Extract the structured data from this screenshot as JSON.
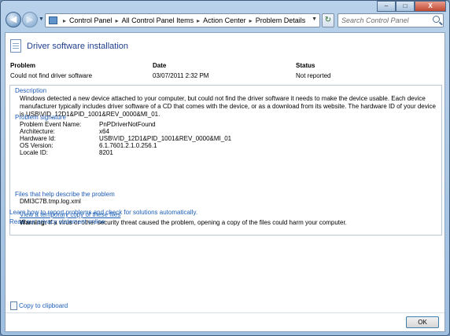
{
  "window": {
    "breadcrumbs": [
      "Control Panel",
      "All Control Panel Items",
      "Action Center",
      "Problem Details"
    ],
    "search_placeholder": "Search Control Panel",
    "buttons": {
      "minimize": "–",
      "maximize": "□",
      "close": "X"
    }
  },
  "page": {
    "title": "Driver software installation",
    "columns": {
      "problem_header": "Problem",
      "problem_value": "Could not find driver software",
      "date_header": "Date",
      "date_value": "03/07/2011 2:32 PM",
      "status_header": "Status",
      "status_value": "Not reported"
    },
    "description": {
      "title": "Description",
      "text": "Windows detected a new device attached to your computer, but could not find the driver software it needs to make the device usable. Each device manufacturer typically includes driver software of a CD that comes with the device, or as a download from its website. The hardware ID of your device is USB\\VID_12D1&PID_1001&REV_0000&MI_01."
    },
    "signature": {
      "title": "Problem signature",
      "rows": [
        {
          "label": "Problem Event Name:",
          "value": "PnPDriverNotFound"
        },
        {
          "label": "Architecture:",
          "value": "x64"
        },
        {
          "label": "Hardware Id:",
          "value": "USB\\VID_12D1&PID_1001&REV_0000&MI_01"
        },
        {
          "label": "OS Version:",
          "value": "6.1.7601.2.1.0.256.1"
        },
        {
          "label": "Locale ID:",
          "value": "8201"
        }
      ]
    },
    "files": {
      "title": "Files that help describe the problem",
      "file": "DMI3C7B.tmp.log.xml",
      "view_link": "View a temporary copy of these files",
      "warning_label": "Warning:",
      "warning_text": " If a virus or other security threat caused the problem, opening a copy of the files could harm your computer."
    },
    "links": {
      "learn": "Learn how to report problems and check for solutions automatically.",
      "privacy": "Read our privacy statement online"
    },
    "footer": {
      "copy": "Copy to clipboard",
      "ok": "OK"
    }
  }
}
